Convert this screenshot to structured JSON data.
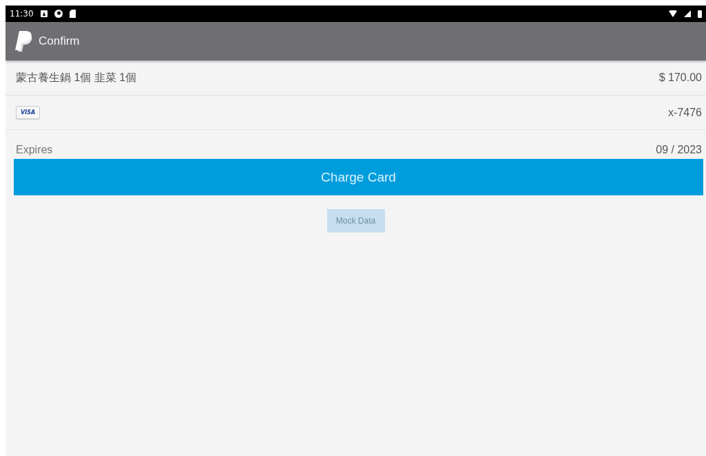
{
  "status_bar": {
    "time": "11:30"
  },
  "app_bar": {
    "title": "Confirm"
  },
  "order": {
    "description": "蒙古養生鍋  1個 韭菜 1個",
    "amount": "$ 170.00"
  },
  "card": {
    "brand": "VISA",
    "number": "x-7476"
  },
  "expiry": {
    "label": "Expires",
    "value": "09 / 2023"
  },
  "charge_button": {
    "label": "Charge Card"
  },
  "mock_button": {
    "label": "Mock Data",
    "disabled": true
  }
}
